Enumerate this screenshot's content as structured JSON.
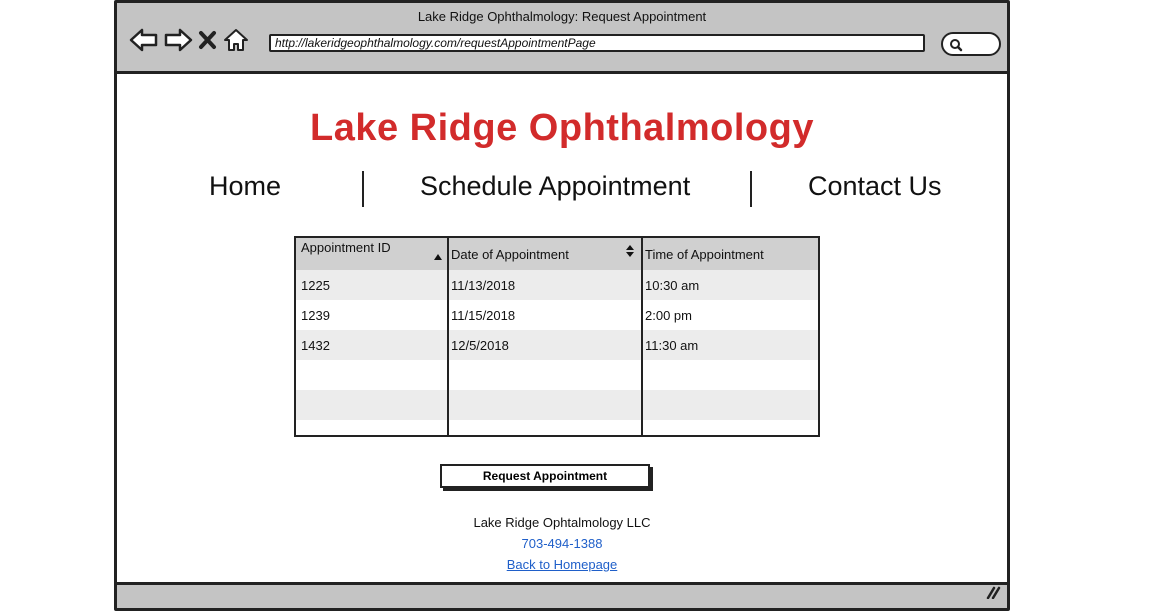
{
  "window": {
    "title": "Lake Ridge Ophthalmology: Request Appointment",
    "url": "http://lakeridgeophthalmology.com/requestAppointmentPage"
  },
  "browser": {
    "icons": [
      "back-arrow-icon",
      "forward-arrow-icon",
      "close-x-icon",
      "home-icon",
      "search-icon",
      "resize-grip-icon"
    ]
  },
  "site": {
    "title": "Lake Ridge Ophthalmology",
    "title_color": "#d22b2b"
  },
  "nav": {
    "home": "Home",
    "schedule": "Schedule Appointment",
    "contact": "Contact Us"
  },
  "table": {
    "columns": [
      "Appointment ID",
      "Date of Appointment",
      "Time of Appointment"
    ],
    "rows": [
      [
        "1225",
        "11/13/2018",
        "10:30 am"
      ],
      [
        "1239",
        "11/15/2018",
        "2:00 pm"
      ],
      [
        "1432",
        "12/5/2018",
        "11:30 am"
      ]
    ]
  },
  "actions": {
    "request_label": "Request Appointment"
  },
  "footer": {
    "company": "Lake Ridge Ophtalmology LLC",
    "phone": "703-494-1388",
    "back_link": "Back to Homepage",
    "link_color": "#1f5fc9"
  }
}
